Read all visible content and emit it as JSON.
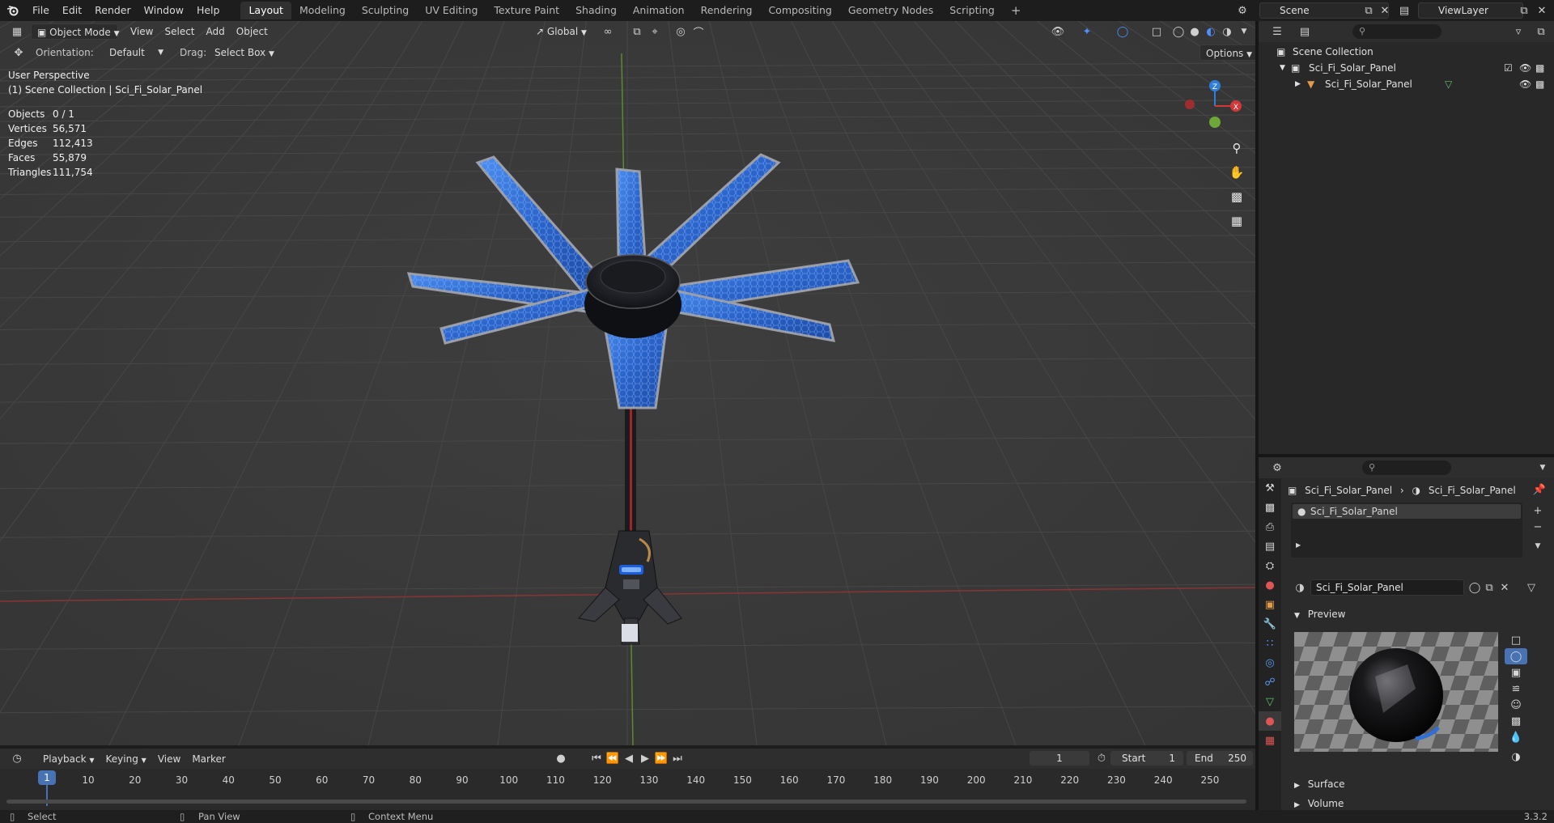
{
  "app": {
    "version": "3.3.2"
  },
  "topbar": {
    "menus": [
      "File",
      "Edit",
      "Render",
      "Window",
      "Help"
    ],
    "workspaces": [
      "Layout",
      "Modeling",
      "Sculpting",
      "UV Editing",
      "Texture Paint",
      "Shading",
      "Animation",
      "Rendering",
      "Compositing",
      "Geometry Nodes",
      "Scripting"
    ],
    "active_workspace": "Layout",
    "add_tab": "+",
    "scene": "Scene",
    "view_layer": "ViewLayer"
  },
  "viewport": {
    "mode": "Object Mode",
    "menus": [
      "View",
      "Select",
      "Add",
      "Object"
    ],
    "transform_space": "Global",
    "orientation_label": "Orientation:",
    "orientation_value": "Default",
    "drag_label": "Drag:",
    "drag_value": "Select Box",
    "options": "Options",
    "perspective": "User Perspective",
    "collection_info": "(1) Scene Collection | Sci_Fi_Solar_Panel",
    "stats": [
      {
        "label": "Objects",
        "value": "0 / 1"
      },
      {
        "label": "Vertices",
        "value": "56,571"
      },
      {
        "label": "Edges",
        "value": "112,413"
      },
      {
        "label": "Faces",
        "value": "55,879"
      },
      {
        "label": "Triangles",
        "value": "111,754"
      }
    ],
    "gizmo_axes": {
      "z": "Z",
      "x": "X"
    },
    "colors": {
      "x_axis": "#d2383a",
      "y_axis": "#6fa638",
      "z_axis": "#2f7fd9",
      "panel_blue": "#2f6fd6"
    }
  },
  "outliner": {
    "root": "Scene Collection",
    "collection": "Sci_Fi_Solar_Panel",
    "object": "Sci_Fi_Solar_Panel"
  },
  "properties": {
    "breadcrumb_object": "Sci_Fi_Solar_Panel",
    "breadcrumb_material": "Sci_Fi_Solar_Panel",
    "slot": "Sci_Fi_Solar_Panel",
    "material_name": "Sci_Fi_Solar_Panel",
    "sections": {
      "preview": "Preview",
      "surface": "Surface",
      "volume": "Volume"
    }
  },
  "timeline": {
    "menus": [
      "Playback",
      "Keying",
      "View",
      "Marker"
    ],
    "current_frame": "1",
    "start_label": "Start",
    "start": "1",
    "end_label": "End",
    "end": "250",
    "frame_marks": [
      "1",
      "10",
      "20",
      "30",
      "40",
      "50",
      "60",
      "70",
      "80",
      "90",
      "100",
      "110",
      "120",
      "130",
      "140",
      "150",
      "160",
      "170",
      "180",
      "190",
      "200",
      "210",
      "220",
      "230",
      "240",
      "250"
    ]
  },
  "statusbar": {
    "select": "Select",
    "pan": "Pan View",
    "context": "Context Menu"
  }
}
